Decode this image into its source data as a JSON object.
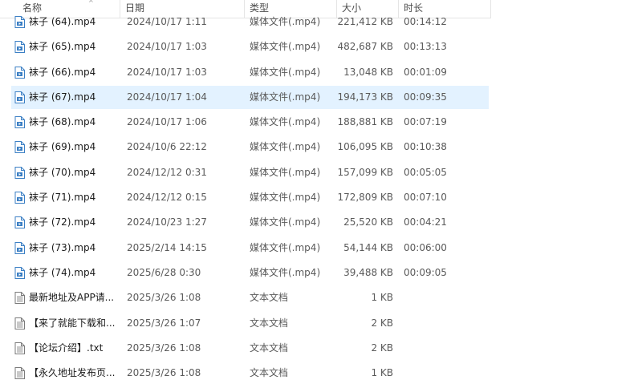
{
  "columns": {
    "name": "名称",
    "date": "日期",
    "type": "类型",
    "size": "大小",
    "duration": "时长"
  },
  "files": [
    {
      "name": "袜子 (64).mp4",
      "date": "2024/10/17 1:11",
      "type": "媒体文件(.mp4)",
      "size": "221,412 KB",
      "duration": "00:14:12",
      "icon": "video-file-icon"
    },
    {
      "name": "袜子 (65).mp4",
      "date": "2024/10/17 1:03",
      "type": "媒体文件(.mp4)",
      "size": "482,687 KB",
      "duration": "00:13:13",
      "icon": "video-file-icon"
    },
    {
      "name": "袜子 (66).mp4",
      "date": "2024/10/17 1:03",
      "type": "媒体文件(.mp4)",
      "size": "13,048 KB",
      "duration": "00:01:09",
      "icon": "video-file-icon"
    },
    {
      "name": "袜子 (67).mp4",
      "date": "2024/10/17 1:04",
      "type": "媒体文件(.mp4)",
      "size": "194,173 KB",
      "duration": "00:09:35",
      "icon": "video-file-icon",
      "selected": true
    },
    {
      "name": "袜子 (68).mp4",
      "date": "2024/10/17 1:06",
      "type": "媒体文件(.mp4)",
      "size": "188,881 KB",
      "duration": "00:07:19",
      "icon": "video-file-icon"
    },
    {
      "name": "袜子 (69).mp4",
      "date": "2024/10/6 22:12",
      "type": "媒体文件(.mp4)",
      "size": "106,095 KB",
      "duration": "00:10:38",
      "icon": "video-file-icon"
    },
    {
      "name": "袜子 (70).mp4",
      "date": "2024/12/12 0:31",
      "type": "媒体文件(.mp4)",
      "size": "157,099 KB",
      "duration": "00:05:05",
      "icon": "video-file-icon"
    },
    {
      "name": "袜子 (71).mp4",
      "date": "2024/12/12 0:15",
      "type": "媒体文件(.mp4)",
      "size": "172,809 KB",
      "duration": "00:07:10",
      "icon": "video-file-icon"
    },
    {
      "name": "袜子 (72).mp4",
      "date": "2024/10/23 1:27",
      "type": "媒体文件(.mp4)",
      "size": "25,520 KB",
      "duration": "00:04:21",
      "icon": "video-file-icon"
    },
    {
      "name": "袜子 (73).mp4",
      "date": "2025/2/14 14:15",
      "type": "媒体文件(.mp4)",
      "size": "54,144 KB",
      "duration": "00:06:00",
      "icon": "video-file-icon"
    },
    {
      "name": "袜子 (74).mp4",
      "date": "2025/6/28 0:30",
      "type": "媒体文件(.mp4)",
      "size": "39,488 KB",
      "duration": "00:09:05",
      "icon": "video-file-icon"
    },
    {
      "name": "最新地址及APP请...",
      "date": "2025/3/26 1:08",
      "type": "文本文档",
      "size": "1 KB",
      "duration": "",
      "icon": "text-file-icon"
    },
    {
      "name": "【来了就能下载和...",
      "date": "2025/3/26 1:07",
      "type": "文本文档",
      "size": "2 KB",
      "duration": "",
      "icon": "text-file-icon"
    },
    {
      "name": "【论坛介绍】.txt",
      "date": "2025/3/26 1:08",
      "type": "文本文档",
      "size": "2 KB",
      "duration": "",
      "icon": "text-file-icon"
    },
    {
      "name": "【永久地址发布页...",
      "date": "2025/3/26 1:08",
      "type": "文本文档",
      "size": "1 KB",
      "duration": "",
      "icon": "text-file-icon"
    }
  ],
  "colors": {
    "selection": "#cce8ff",
    "video_icon": "#3b7fc4",
    "text_icon": "#7a7a7a"
  }
}
